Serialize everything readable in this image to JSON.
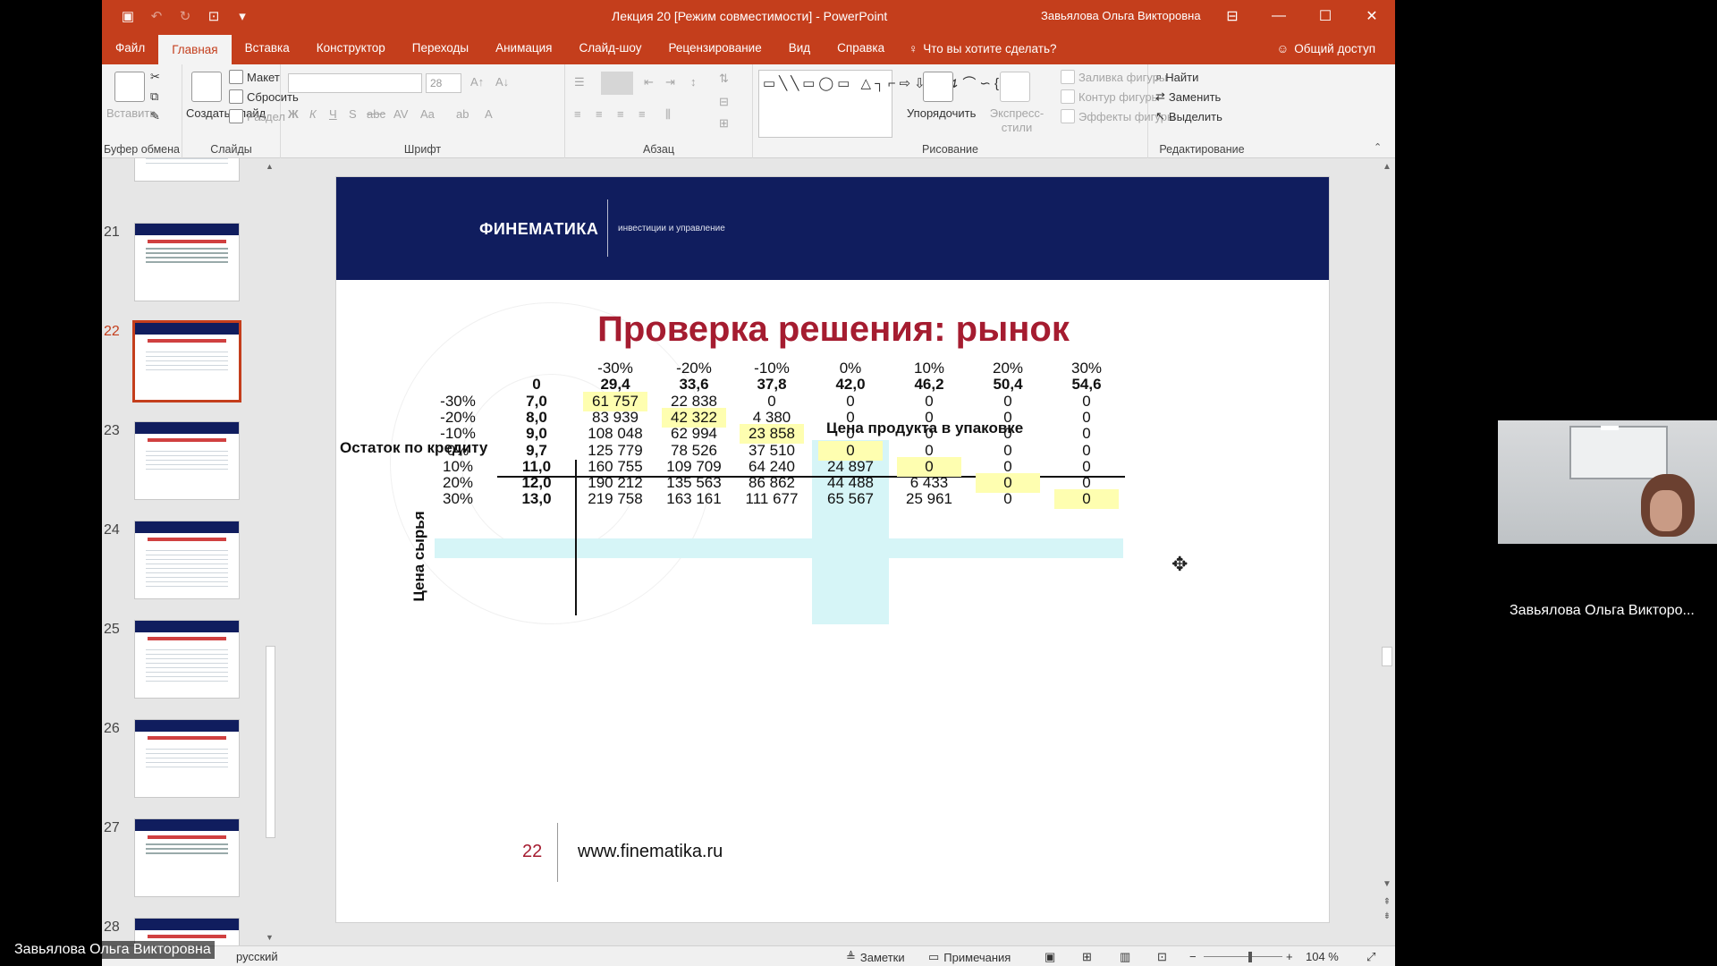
{
  "titlebar": {
    "doc_title": "Лекция 20 [Режим совместимости]  -  PowerPoint",
    "user_name": "Завьялова Ольга Викторовна"
  },
  "tabs": [
    "Файл",
    "Главная",
    "Вставка",
    "Конструктор",
    "Переходы",
    "Анимация",
    "Слайд-шоу",
    "Рецензирование",
    "Вид",
    "Справка"
  ],
  "tell_me": "Что вы хотите сделать?",
  "share": "Общий доступ",
  "ribbon": {
    "paste": "Вставить",
    "clipboard": "Буфер обмена",
    "create_slide": "Создать слайд",
    "layout": "Макет",
    "reset": "Сбросить",
    "section": "Раздел",
    "slides": "Слайды",
    "font_size": "28",
    "font": "Шрифт",
    "paragraph": "Абзац",
    "arrange": "Упорядочить",
    "quick_styles": "Экспресс-стили",
    "shape_fill": "Заливка фигуры",
    "shape_outline": "Контур фигуры",
    "shape_effects": "Эффекты фигуры",
    "drawing": "Рисование",
    "find": "Найти",
    "replace": "Заменить",
    "select": "Выделить",
    "editing": "Редактирование"
  },
  "thumbnails": [
    {
      "num": "21",
      "active": false
    },
    {
      "num": "22",
      "active": true
    },
    {
      "num": "23",
      "active": false
    },
    {
      "num": "24",
      "active": false
    },
    {
      "num": "25",
      "active": false
    },
    {
      "num": "26",
      "active": false
    },
    {
      "num": "27",
      "active": false
    },
    {
      "num": "28",
      "active": false
    }
  ],
  "slide": {
    "logo": "ФИНЕМАТИКА",
    "logo_tag": "инвестиции и управление",
    "title": "Проверка решения: рынок",
    "table_title": "Цена продукта в упаковке",
    "row_axis_label": "Остаток по кредиту",
    "vertical_label": "Цена сырья",
    "col_pct": [
      "-30%",
      "-20%",
      "-10%",
      "0%",
      "10%",
      "20%",
      "30%"
    ],
    "col_price": [
      "0",
      "29,4",
      "33,6",
      "37,8",
      "42,0",
      "46,2",
      "50,4",
      "54,6"
    ],
    "rows": [
      {
        "pct": "-30%",
        "price": "7,0",
        "vals": [
          "61 757",
          "22 838",
          "0",
          "0",
          "0",
          "0",
          "0"
        ]
      },
      {
        "pct": "-20%",
        "price": "8,0",
        "vals": [
          "83 939",
          "42 322",
          "4 380",
          "0",
          "0",
          "0",
          "0"
        ]
      },
      {
        "pct": "-10%",
        "price": "9,0",
        "vals": [
          "108 048",
          "62 994",
          "23 858",
          "0",
          "0",
          "0",
          "0"
        ]
      },
      {
        "pct": "0%",
        "price": "9,7",
        "vals": [
          "125 779",
          "78 526",
          "37 510",
          "0",
          "0",
          "0",
          "0"
        ]
      },
      {
        "pct": "10%",
        "price": "11,0",
        "vals": [
          "160 755",
          "109 709",
          "64 240",
          "24 897",
          "0",
          "0",
          "0"
        ]
      },
      {
        "pct": "20%",
        "price": "12,0",
        "vals": [
          "190 212",
          "135 563",
          "86 862",
          "44 488",
          "6 433",
          "0",
          "0"
        ]
      },
      {
        "pct": "30%",
        "price": "13,0",
        "vals": [
          "219 758",
          "163 161",
          "111 677",
          "65 567",
          "25 961",
          "0",
          "0"
        ]
      }
    ],
    "page_num": "22",
    "url": "www.finematika.ru"
  },
  "status": {
    "language": "русский",
    "notes": "Заметки",
    "comments": "Примечания",
    "zoom": "104 %"
  },
  "overlay": {
    "webcam_name": "Завьялова Ольга Викторо...",
    "presenter_name": "Завьялова Ольга Викторовна"
  },
  "colors": {
    "ppt_accent": "#c43e1c",
    "slide_header": "#101d5e",
    "title_red": "#a51c30",
    "highlight_yellow": "#fefeb0",
    "highlight_cyan": "#d6f5f7"
  }
}
